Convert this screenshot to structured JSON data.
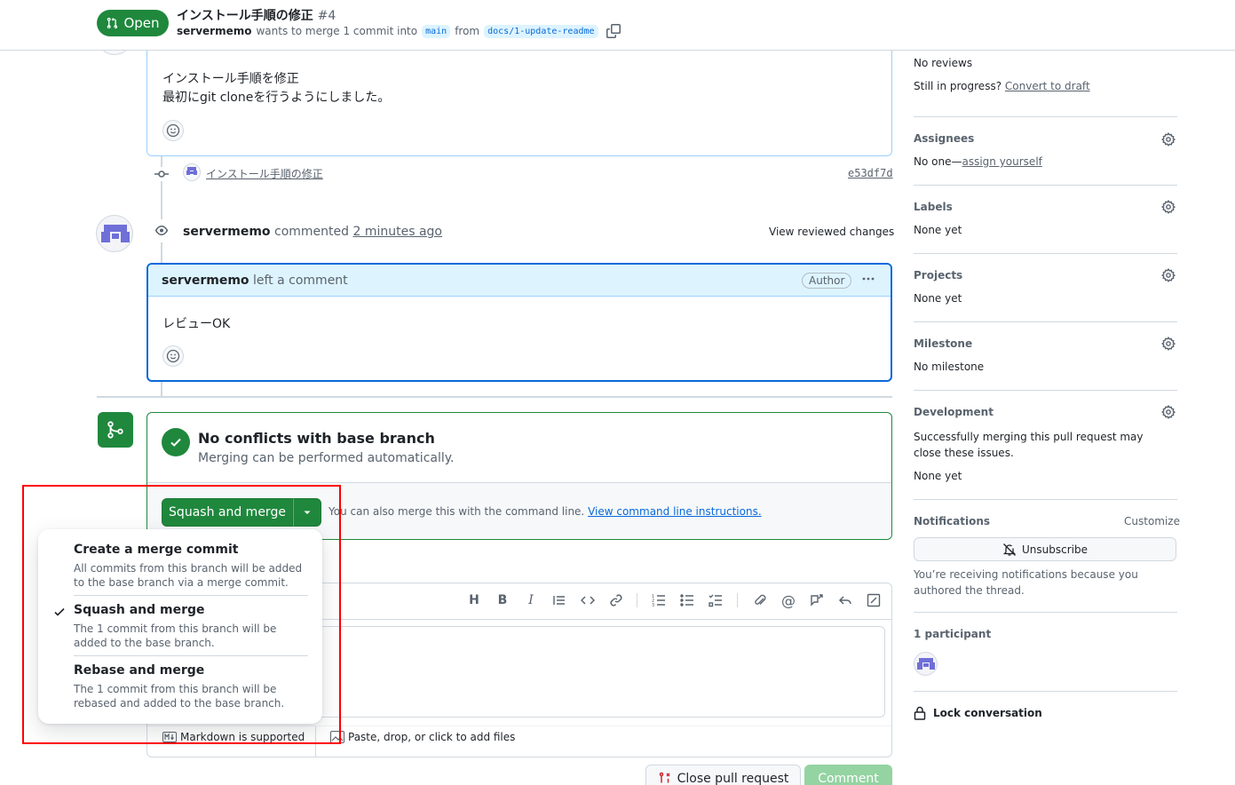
{
  "header": {
    "state": "Open",
    "title": "インストール手順の修正",
    "number": "#4",
    "author": "servermemo",
    "merge_text": "wants to merge 1 commit into",
    "base_branch": "main",
    "from_text": "from",
    "head_branch": "docs/1-update-readme"
  },
  "first_comment": {
    "line1": "インストール手順を修正",
    "line2": "最初にgit cloneを行うようにしました。"
  },
  "commit": {
    "message": "インストール手順の修正",
    "sha": "e53df7d"
  },
  "review": {
    "user": "servermemo",
    "action": "commented",
    "time": "2 minutes ago",
    "view_changes": "View reviewed changes",
    "comment_user": "servermemo",
    "comment_action": "left a comment",
    "badge": "Author",
    "body": "レビューOK"
  },
  "merge_box": {
    "title": "No conflicts with base branch",
    "subtitle": "Merging can be performed automatically.",
    "button": "Squash and merge",
    "cli_text": "You can also merge this with the command line.",
    "cli_link": "View command line instructions."
  },
  "merge_menu": {
    "items": [
      {
        "title": "Create a merge commit",
        "desc": "All commits from this branch will be added to the base branch via a merge commit.",
        "selected": false
      },
      {
        "title": "Squash and merge",
        "desc": "The 1 commit from this branch will be added to the base branch.",
        "selected": true
      },
      {
        "title": "Rebase and merge",
        "desc": "The 1 commit from this branch will be rebased and added to the base branch.",
        "selected": false
      }
    ]
  },
  "editor": {
    "markdown": "Markdown is supported",
    "attach": "Paste, drop, or click to add files"
  },
  "footer_buttons": {
    "close": "Close pull request",
    "comment": "Comment"
  },
  "sidebar": {
    "reviewers_value": "No reviews",
    "in_progress": "Still in progress?",
    "convert_draft": "Convert to draft",
    "assignees_head": "Assignees",
    "assignees_value": "No one—",
    "assign_yourself": "assign yourself",
    "labels_head": "Labels",
    "labels_value": "None yet",
    "projects_head": "Projects",
    "projects_value": "None yet",
    "milestone_head": "Milestone",
    "milestone_value": "No milestone",
    "development_head": "Development",
    "development_desc": "Successfully merging this pull request may close these issues.",
    "development_value": "None yet",
    "notifications_head": "Notifications",
    "customize": "Customize",
    "unsubscribe": "Unsubscribe",
    "notify_reason": "You’re receiving notifications because you authored the thread.",
    "participants": "1 participant",
    "lock": "Lock conversation"
  },
  "colors": {
    "green": "#1f883d",
    "blue": "#0969da",
    "border": "#d1d9e0",
    "highlight": "#ff0000"
  }
}
